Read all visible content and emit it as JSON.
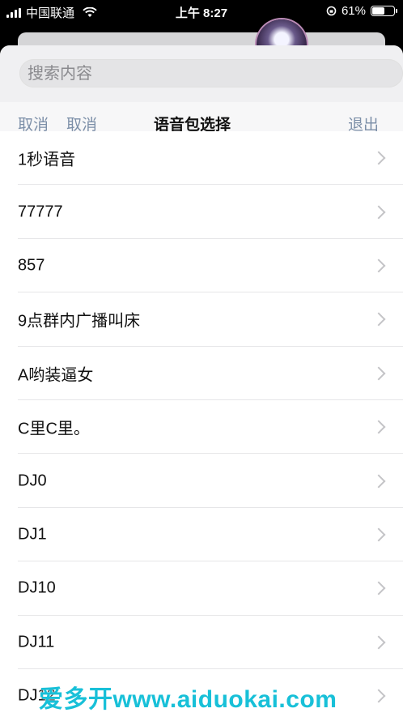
{
  "status_bar": {
    "carrier": "中国联通",
    "time": "上午 8:27",
    "battery_text": "61%",
    "battery_level": 0.61
  },
  "search": {
    "placeholder": "搜索内容"
  },
  "nav": {
    "left1": "取消",
    "left2": "取消",
    "title": "语音包选择",
    "right": "退出"
  },
  "list": {
    "items": [
      {
        "label": "1秒语音"
      },
      {
        "label": "77777"
      },
      {
        "label": "857"
      },
      {
        "label": "9点群内广播叫床"
      },
      {
        "label": "A哟装逼女"
      },
      {
        "label": "C里C里。"
      },
      {
        "label": "DJ0"
      },
      {
        "label": "DJ1"
      },
      {
        "label": "DJ10"
      },
      {
        "label": "DJ11"
      },
      {
        "label": "DJ12"
      }
    ]
  },
  "watermark": {
    "text": "爱多开www.aiduokai.com"
  },
  "colors": {
    "accent_nav": "#7c8fa8",
    "watermark": "#18c0d8"
  }
}
